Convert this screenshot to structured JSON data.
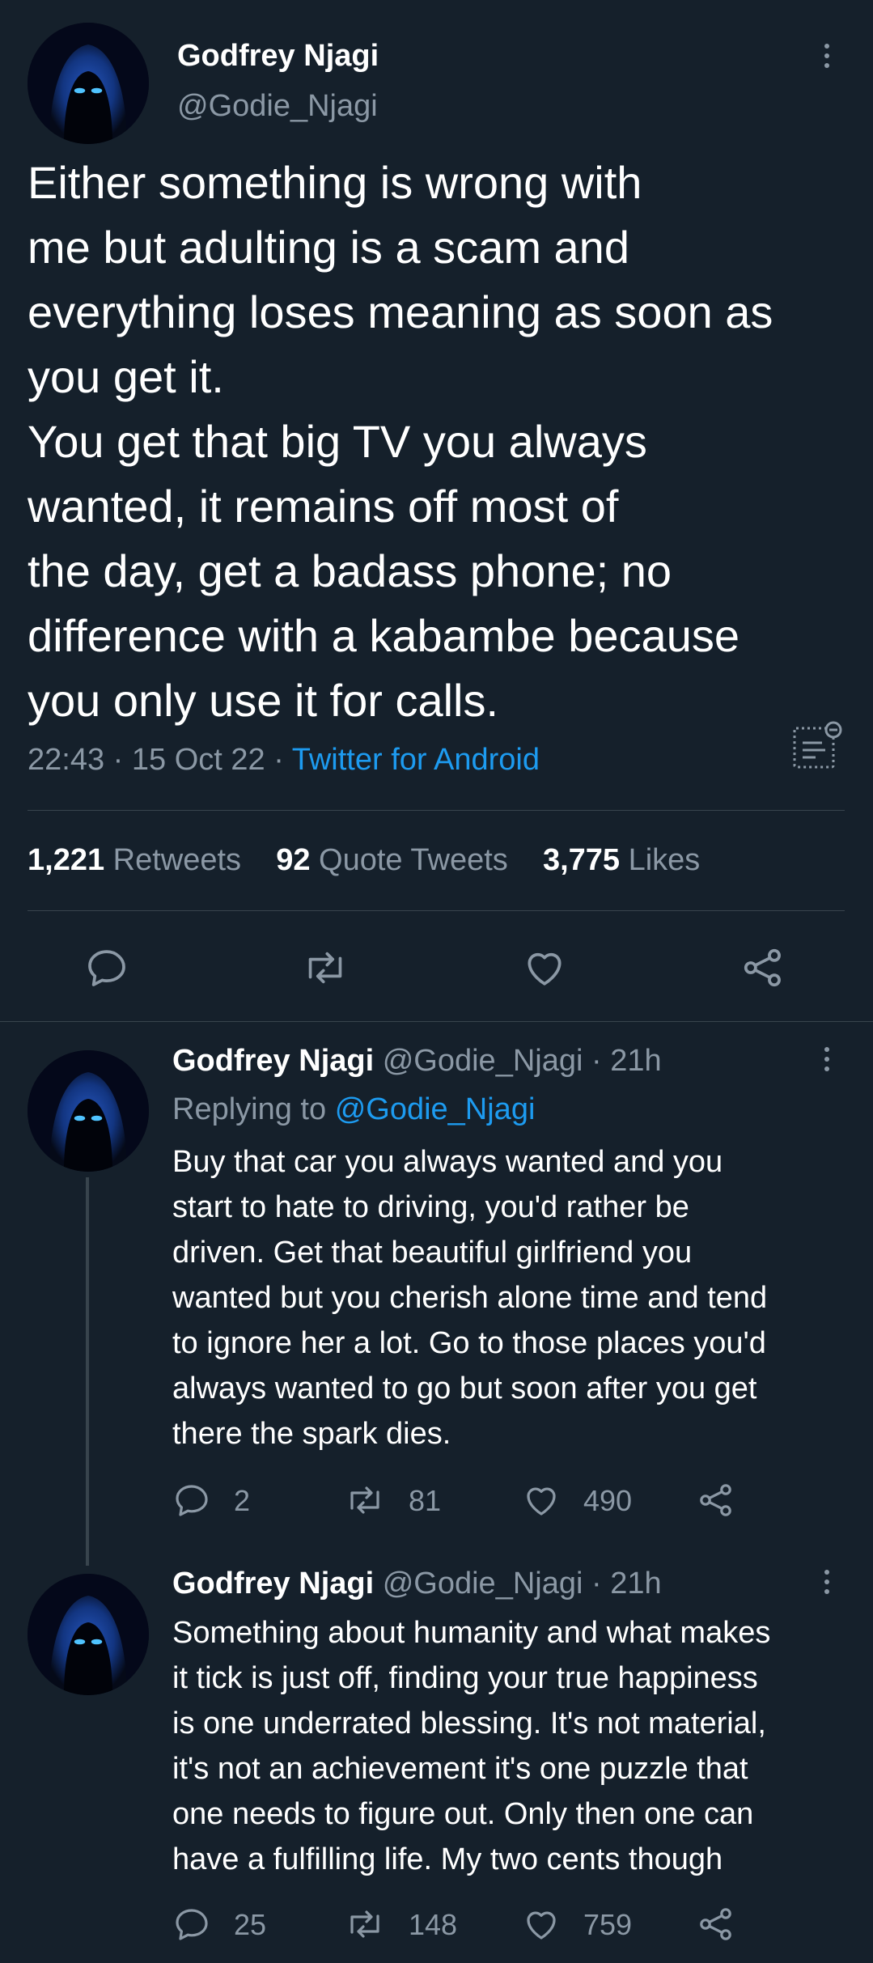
{
  "main_tweet": {
    "author_name": "Godfrey Njagi",
    "handle": "@Godie_Njagi",
    "text_lines": [
      "Either something is wrong with",
      "me but adulting is a scam and",
      "everything loses meaning as soon as",
      "you get it.",
      "You get that big TV you always",
      "wanted, it remains off most of",
      "the day, get a badass phone; no",
      "difference with a kabambe because",
      "you only use it for calls."
    ],
    "time": "22:43",
    "sep1": "·",
    "date": "15 Oct 22",
    "sep2": "·",
    "source": "Twitter for Android",
    "stats": {
      "retweets_count": "1,221",
      "retweets_label": "Retweets",
      "quotes_count": "92",
      "quotes_label": "Quote Tweets",
      "likes_count": "3,775",
      "likes_label": "Likes"
    }
  },
  "replies": [
    {
      "author_name": "Godfrey Njagi",
      "handle": "@Godie_Njagi",
      "meta": "· 21h",
      "replying_prefix": "Replying to",
      "replying_handle": "@Godie_Njagi",
      "text_lines": [
        "Buy that car you always wanted and  you",
        "start to hate to driving, you'd rather be",
        "driven. Get that beautiful girlfriend you",
        "wanted but you cherish alone time and tend",
        "to ignore her a lot. Go to those places you'd",
        "always wanted to go but soon after you get",
        "there the spark dies."
      ],
      "reply_count": "2",
      "retweet_count": "81",
      "like_count": "490"
    },
    {
      "author_name": "Godfrey Njagi",
      "handle": "@Godie_Njagi",
      "meta": "· 21h",
      "text_lines": [
        "Something about humanity and what makes",
        "it tick is just off, finding your true happiness",
        "is one underrated blessing. It's not material,",
        "it's not an achievement it's one puzzle that",
        "one needs to figure out. Only then one can",
        "have a fulfilling life. My two cents though"
      ],
      "reply_count": "25",
      "retweet_count": "148",
      "like_count": "759"
    }
  ],
  "icons": {
    "more": "more-vertical-icon",
    "reply": "reply-icon",
    "retweet": "retweet-icon",
    "like": "heart-icon",
    "share": "share-icon",
    "analytics": "tweet-analytics-icon"
  },
  "colors": {
    "background": "#15202b",
    "text": "#ffffff",
    "muted": "#8b98a5",
    "accent": "#1d9bf0",
    "divider": "#38444d"
  }
}
